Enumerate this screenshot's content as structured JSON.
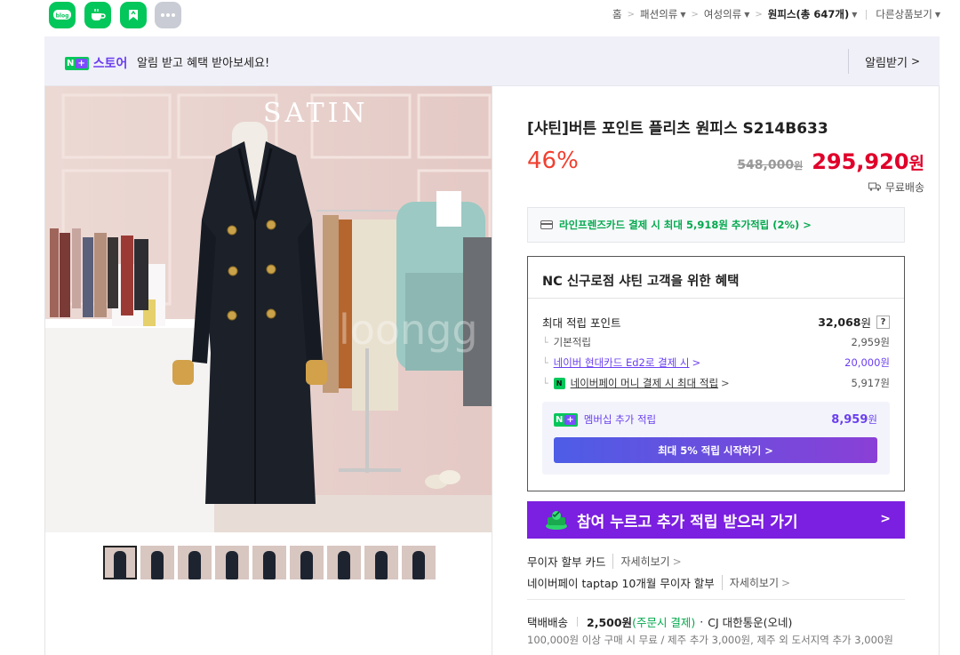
{
  "topbar": {
    "apps": [
      {
        "icon": "blog-icon",
        "label": "blog"
      },
      {
        "icon": "cafe-icon",
        "label": ""
      },
      {
        "icon": "bookmark-icon",
        "label": ""
      },
      {
        "icon": "more-icon",
        "label": ""
      }
    ],
    "breadcrumb": {
      "home": "홈",
      "level1": "패션의류",
      "level2": "여성의류",
      "current": "원피스(총 647개)",
      "other": "다른상품보기"
    }
  },
  "banner": {
    "store_label": "스토어",
    "message": "알림 받고 혜택 받아보세요!",
    "subscribe_label": "알림받기"
  },
  "product": {
    "title": "[샤틴]버튼 포인트 플리츠 원피스 S214B633",
    "discount": "46%",
    "original_price": "548,000",
    "original_unit": "원",
    "sale_price": "295,920",
    "sale_unit": "원",
    "shipping_label": "무료배송",
    "photo_sign": "SATIN",
    "photo_watermark": "loongg",
    "thumbnail_count": 9,
    "selected_thumbnail": 1
  },
  "card_offer": {
    "text": "라인프렌즈카드 결제 시 최대 5,918원 추가적립 (2%)",
    "arrow": ">"
  },
  "benefit": {
    "heading": "NC 신구로점 샤틴 고객을 위한 혜택",
    "max_points_label": "최대 적립 포인트",
    "max_points_value": "32,068",
    "max_points_unit": "원",
    "help": "?",
    "rows": [
      {
        "label": "기본적립",
        "value": "2,959원"
      },
      {
        "label": "네이버 현대카드 Ed2로 결제 시",
        "value": "20,000원"
      },
      {
        "label": "네이버페이 머니 결제 시 최대 적립",
        "value": "5,917원"
      }
    ],
    "membership_label": "멤버십 추가 적립",
    "membership_value": "8,959",
    "membership_unit": "원",
    "membership_button": "최대 5% 적립 시작하기 >"
  },
  "promo": {
    "text": "참여 누르고 추가 적립 받으러 가기",
    "arrow": ">"
  },
  "installment": [
    {
      "label": "무이자 할부 카드",
      "more": "자세히보기"
    },
    {
      "label": "네이버페이 taptap 10개월 무이자 할부",
      "more": "자세히보기"
    }
  ],
  "delivery": {
    "type": "택배배송",
    "fee": "2,500원",
    "condition": "(주문시 결제)",
    "carrier": "CJ 대한통운(오네)",
    "notice": "100,000원 이상 구매 시 무료 / 제주 추가 3,000원, 제주 외 도서지역 추가 3,000원"
  },
  "colors": {
    "naver_green": "#03c75a",
    "purple": "#6a3ff0",
    "discount_red": "#f04030",
    "price_red": "#e0002a",
    "promo_purple": "#7b1fe0"
  }
}
